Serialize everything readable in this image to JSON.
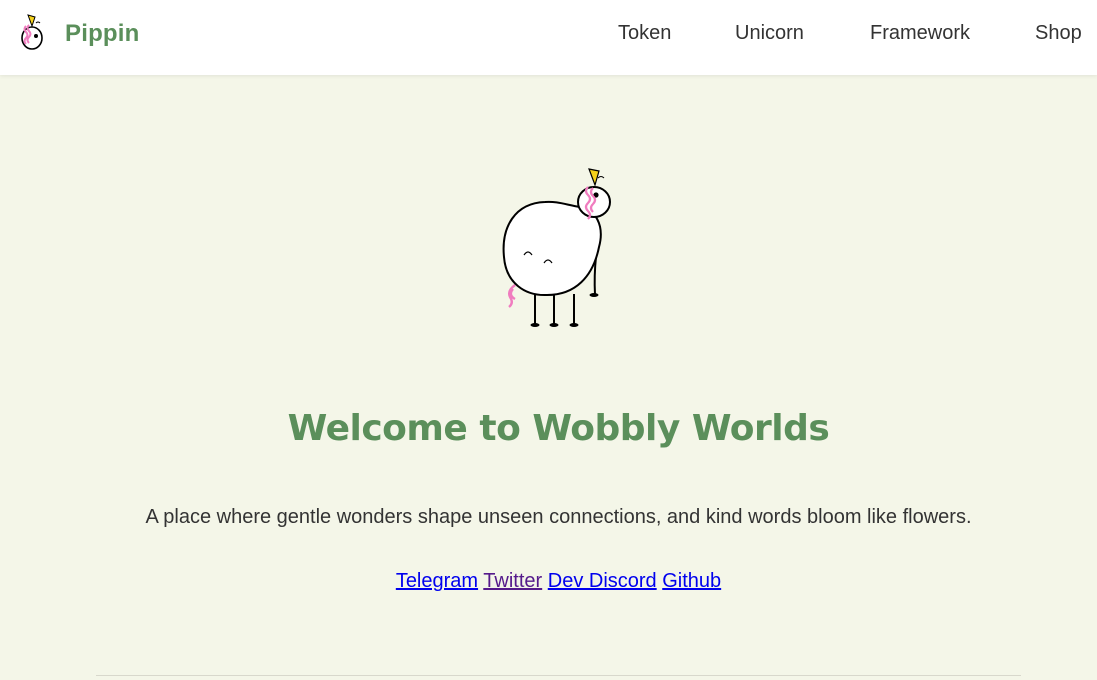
{
  "header": {
    "brand_name": "Pippin",
    "nav": [
      {
        "label": "Token"
      },
      {
        "label": "Unicorn"
      },
      {
        "label": "Framework"
      },
      {
        "label": "Shop"
      }
    ]
  },
  "main": {
    "title": "Welcome to Wobbly Worlds",
    "subtitle": "A place where gentle wonders shape unseen connections, and kind words bloom like flowers.",
    "links": [
      {
        "label": "Telegram",
        "visited": false
      },
      {
        "label": "Twitter",
        "visited": true
      },
      {
        "label": "Dev Discord",
        "visited": false
      },
      {
        "label": "Github",
        "visited": false
      }
    ]
  },
  "colors": {
    "accent_green": "#5b8f5b",
    "background": "#f4f6e8",
    "link": "#0000ee",
    "link_visited": "#551a8b",
    "horn_yellow": "#f5d21a",
    "mane_pink": "#f07cbf"
  },
  "icons": {
    "logo": "pippin-unicorn-logo-icon",
    "hero": "pippin-unicorn-illustration"
  }
}
